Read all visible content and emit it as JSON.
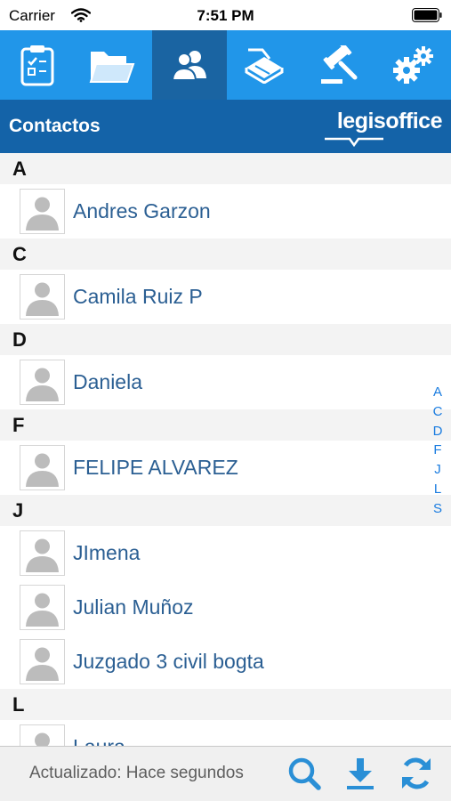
{
  "status_bar": {
    "carrier": "Carrier",
    "time": "7:51 PM"
  },
  "tabs": [
    {
      "name": "clipboard-checklist-icon",
      "active": false
    },
    {
      "name": "folder-icon",
      "active": false
    },
    {
      "name": "contacts-icon",
      "active": true
    },
    {
      "name": "scanner-icon",
      "active": false
    },
    {
      "name": "gavel-icon",
      "active": false
    },
    {
      "name": "gears-icon",
      "active": false
    }
  ],
  "header": {
    "title": "Contactos",
    "brand": "legisoffice"
  },
  "sections": [
    {
      "letter": "A",
      "contacts": [
        "Andres Garzon"
      ]
    },
    {
      "letter": "C",
      "contacts": [
        "Camila Ruiz P"
      ]
    },
    {
      "letter": "D",
      "contacts": [
        "Daniela"
      ]
    },
    {
      "letter": "F",
      "contacts": [
        "FELIPE ALVAREZ"
      ]
    },
    {
      "letter": "J",
      "contacts": [
        "JImena",
        "Julian Muñoz",
        "Juzgado 3 civil bogta"
      ]
    },
    {
      "letter": "L",
      "contacts": [
        "Laura"
      ]
    }
  ],
  "index": [
    "A",
    "C",
    "D",
    "F",
    "J",
    "L",
    "S"
  ],
  "bottom_bar": {
    "updated_label": "Actualizado: Hace segundos"
  },
  "colors": {
    "tabbar": "#2196e9",
    "tab_active": "#1a64a2",
    "header": "#1463a8",
    "name_text": "#2b5f93",
    "index_text": "#1a7ce0",
    "icon_blue": "#2a8fd6"
  }
}
